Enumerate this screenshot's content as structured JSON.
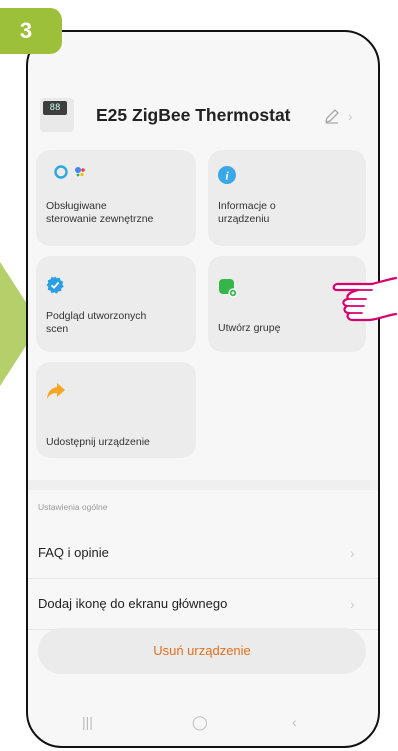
{
  "step": {
    "number": "3"
  },
  "header": {
    "device_display": "88",
    "title": "E25 ZigBee Thermostat"
  },
  "cards": [
    {
      "id": "ext-control",
      "label_line1": "Obsługiwane",
      "label_line2": "sterowanie zewnętrzne"
    },
    {
      "id": "device-info",
      "label_line1": "Informacje o",
      "label_line2": "urządzeniu"
    },
    {
      "id": "scenes",
      "label_line1": "Podgląd utworzonych",
      "label_line2": "scen"
    },
    {
      "id": "create-group",
      "label_line1": "Utwórz grupę",
      "label_line2": ""
    },
    {
      "id": "share",
      "label_line1": "Udostępnij urządzenie",
      "label_line2": ""
    }
  ],
  "settings": {
    "section_label": "Ustawienia ogólne",
    "items": [
      {
        "label": "FAQ i opinie"
      },
      {
        "label": "Dodaj ikonę do ekranu głównego"
      }
    ]
  },
  "delete_button": {
    "label": "Usuń urządzenie"
  },
  "colors": {
    "accent_green": "#9dc03a",
    "delete_orange": "#e07020",
    "hand_pink": "#d6006e"
  }
}
